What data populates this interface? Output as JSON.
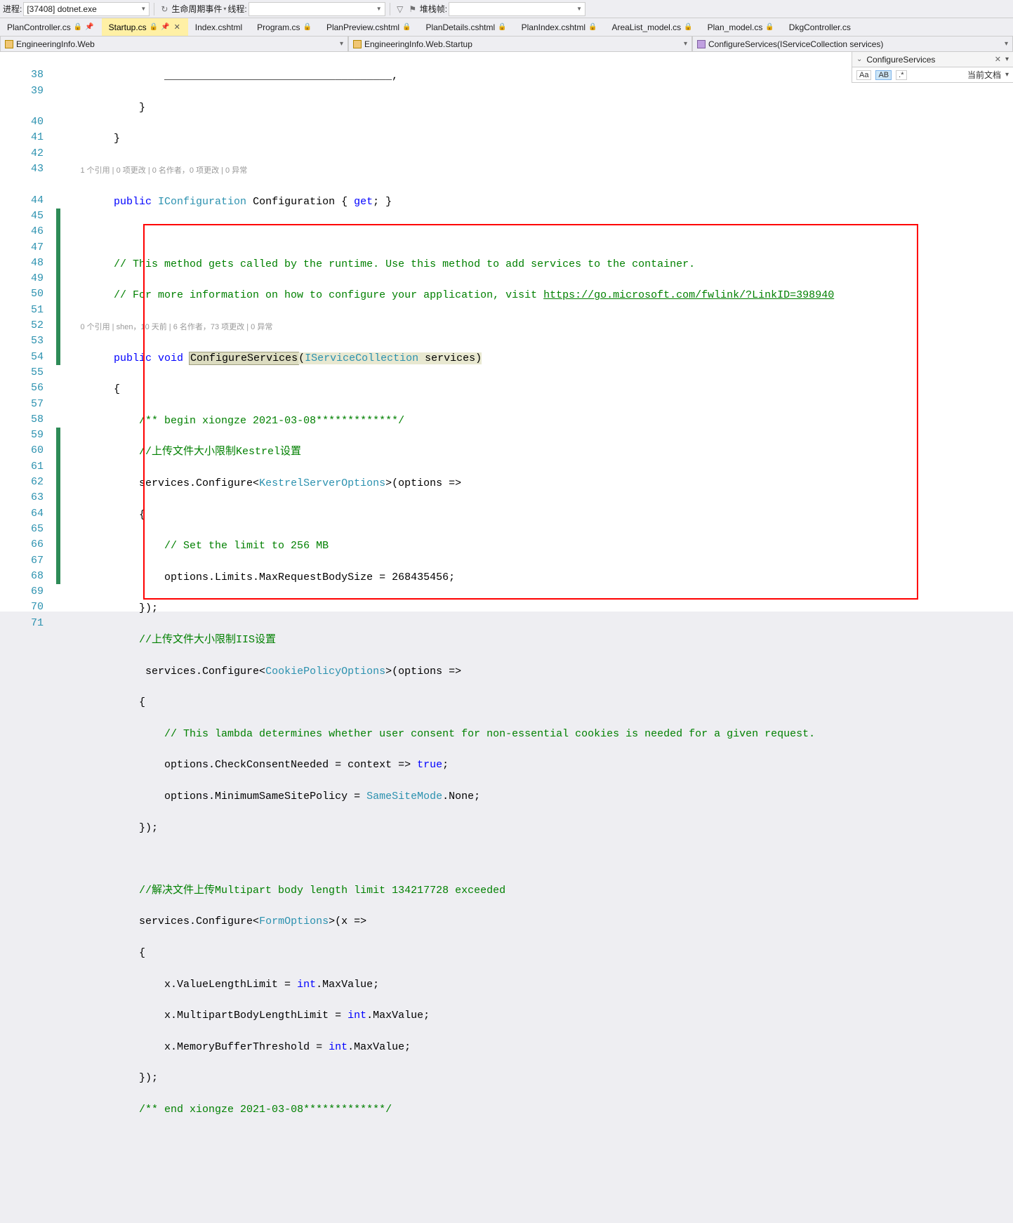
{
  "toolbar": {
    "process_label": "进程:",
    "process_value": "[37408] dotnet.exe",
    "lifecycle_label": "生命周期事件",
    "thread_label": "线程:",
    "thread_value": "",
    "stack_label": "堆栈帧:",
    "stack_value": ""
  },
  "tabs": [
    {
      "label": "PlanController.cs",
      "active": false,
      "pin": true,
      "close": false
    },
    {
      "label": "Startup.cs",
      "active": true,
      "pin": true,
      "close": true
    },
    {
      "label": "Index.cshtml",
      "active": false,
      "pin": false,
      "close": false
    },
    {
      "label": "Program.cs",
      "active": false,
      "pin": true,
      "close": false
    },
    {
      "label": "PlanPreview.cshtml",
      "active": false,
      "pin": true,
      "close": false
    },
    {
      "label": "PlanDetails.cshtml",
      "active": false,
      "pin": true,
      "close": false
    },
    {
      "label": "PlanIndex.cshtml",
      "active": false,
      "pin": true,
      "close": false
    },
    {
      "label": "AreaList_model.cs",
      "active": false,
      "pin": true,
      "close": false
    },
    {
      "label": "Plan_model.cs",
      "active": false,
      "pin": true,
      "close": false
    },
    {
      "label": "DkgController.cs",
      "active": false,
      "pin": false,
      "close": false
    }
  ],
  "breadcrumb": {
    "seg1": "EngineeringInfo.Web",
    "seg2": "EngineeringInfo.Web.Startup",
    "seg3": "ConfigureServices(IServiceCollection services)"
  },
  "right_panel": {
    "title": "ConfigureServices",
    "scope": "当前文档",
    "aa": "Aa",
    "ab": "AB",
    "re": ".*"
  },
  "codelens": {
    "lens1": "1 个引用 | 0 项更改 | 0 名作者，0 项更改 | 0 异常",
    "lens2": "0 个引用 | shen，10 天前 | 6 名作者，73 项更改 | 0 异常"
  },
  "code": {
    "l38": "            }",
    "l39": "}",
    "l40_public": "public ",
    "l40_iconfig": "IConfiguration",
    "l40_config": " Configuration { ",
    "l40_get": "get",
    "l40_end": "; }",
    "l42": "// This method gets called by the runtime. Use this method to add services to the container.",
    "l43a": "// For more information on how to configure your application, visit ",
    "l43b": "https://go.microsoft.com/fwlink/?LinkID=398940",
    "l44_public": "public ",
    "l44_void": "void ",
    "l44_method": "ConfigureServices",
    "l44_paren1": "(",
    "l44_iservice": "IServiceCollection",
    "l44_services": " services)",
    "l45": "{",
    "l46": "/** begin xiongze 2021-03-08*************/",
    "l47": "//上传文件大小限制Kestrel设置",
    "l48_a": "services.Configure<",
    "l48_b": "KestrelServerOptions",
    "l48_c": ">(options =>",
    "l49": "{",
    "l50": "// Set the limit to 256 MB",
    "l51": "options.Limits.MaxRequestBodySize = 268435456;",
    "l52": "});",
    "l53": "//上传文件大小限制IIS设置",
    "l54_a": " services.Configure<",
    "l54_b": "CookiePolicyOptions",
    "l54_c": ">(options =>",
    "l55": "{",
    "l56": "// This lambda determines whether user consent for non-essential cookies is needed for a given request.",
    "l57_a": "options.CheckConsentNeeded = context => ",
    "l57_b": "true",
    "l57_c": ";",
    "l58_a": "options.MinimumSameSitePolicy = ",
    "l58_b": "SameSiteMode",
    "l58_c": ".None;",
    "l59": "});",
    "l61": "//解决文件上传Multipart body length limit 134217728 exceeded",
    "l62_a": "services.Configure<",
    "l62_b": "FormOptions",
    "l62_c": ">(x =>",
    "l63": "{",
    "l64_a": "x.ValueLengthLimit = ",
    "l64_b": "int",
    "l64_c": ".MaxValue;",
    "l65_a": "x.MultipartBodyLengthLimit = ",
    "l65_b": "int",
    "l65_c": ".MaxValue;",
    "l66_a": "x.MemoryBufferThreshold = ",
    "l66_b": "int",
    "l66_c": ".MaxValue;",
    "l67": "});",
    "l68": "/** end xiongze 2021-03-08*************/"
  },
  "line_numbers": [
    "",
    "38",
    "39",
    "",
    "40",
    "41",
    "42",
    "43",
    "",
    "44",
    "45",
    "46",
    "47",
    "48",
    "49",
    "50",
    "51",
    "52",
    "53",
    "54",
    "55",
    "56",
    "57",
    "58",
    "59",
    "60",
    "61",
    "62",
    "63",
    "64",
    "65",
    "66",
    "67",
    "68",
    "69",
    "70",
    "71"
  ]
}
